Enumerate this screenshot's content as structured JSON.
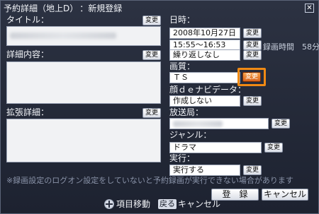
{
  "window": {
    "title": "予約詳細（地上D）",
    "mode": "：新規登録",
    "close_icon": "close-icon"
  },
  "common": {
    "change_label": "変更"
  },
  "left": {
    "title_label": "タイトル：",
    "details_label": "詳細内容：",
    "extended_label": "拡張詳細："
  },
  "right": {
    "datetime_label": "日時：",
    "date_value": "2008年10月27日（月）",
    "time_value": "15:55～16:53",
    "repeat_value": "繰り返しなし",
    "rec_duration": "録画時間　58分",
    "quality_label": "画質：",
    "quality_value": "ＴＳ",
    "navi_label": "顔ｄｅナビデータ：",
    "navi_value": "作成しない",
    "station_label": "放送局：",
    "genre_label": "ジャンル：",
    "genre_value": "ドラマ",
    "exec_label": "実行：",
    "exec_value": "実行する"
  },
  "notice": "※録画設定のログオン設定をしていないと予約録画が実行できない場合があります",
  "buttons": {
    "register": "登　録",
    "cancel": "キャンセル"
  },
  "footer": {
    "dpad_icon": "dpad-icon",
    "move_label": "項目移動",
    "back_key": "戻る",
    "back_label": "キャンセル"
  },
  "colors": {
    "accent": "#f08a14",
    "background": "#1f2330"
  }
}
